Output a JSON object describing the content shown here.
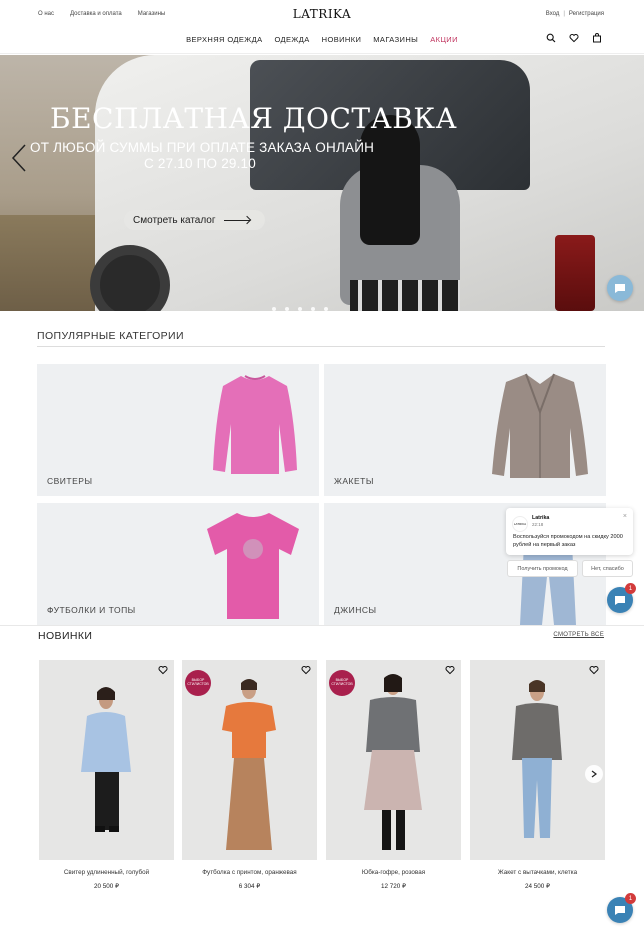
{
  "header": {
    "links": [
      "О нас",
      "Доставка и оплата",
      "Магазины"
    ],
    "logo": "LATRIKA",
    "login": "Вход",
    "separator": "|",
    "register": "Регистрация",
    "nav": [
      "ВЕРХНЯЯ ОДЕЖДА",
      "ОДЕЖДА",
      "НОВИНКИ",
      "МАГАЗИНЫ"
    ],
    "nav_promo": "АКЦИИ",
    "icons": [
      "search-icon",
      "heart-icon",
      "bag-icon"
    ]
  },
  "hero": {
    "title": "БЕСПЛАТНАЯ ДОСТАВКА",
    "subtitle_line1": "ОТ ЛЮБОЙ СУММЫ ПРИ ОПЛАТЕ ЗАКАЗА ОНЛАЙН",
    "subtitle_line2": "С 27.10 ПО 29.10",
    "button": "Смотреть каталог",
    "dots": 5
  },
  "categories": {
    "title": "ПОПУЛЯРНЫЕ КАТЕГОРИИ",
    "items": [
      "СВИТЕРЫ",
      "ЖАКЕТЫ",
      "ФУТБОЛКИ И ТОПЫ",
      "ДЖИНСЫ"
    ]
  },
  "novelties": {
    "title": "НОВИНКИ",
    "see_all": "СМОТРЕТЬ ВСЕ",
    "badge": "ВЫБОР СТИЛИСТОВ",
    "products": [
      {
        "name": "Свитер удлиненный, голубой",
        "price": "20 500 ₽"
      },
      {
        "name": "Футболка с принтом, оранжевая",
        "price": "6 304 ₽"
      },
      {
        "name": "Юбка-гофре, розовая",
        "price": "12 720 ₽"
      },
      {
        "name": "Жакет с вытачками, клетка",
        "price": "24 500 ₽"
      }
    ]
  },
  "chat": {
    "name": "Latrika",
    "time": "22:18",
    "avatar": "LATRIKA",
    "message": "Воспользуйся промокодом на скидку 2000 рублей на первый заказ",
    "btn_yes": "Получить промокод",
    "btn_no": "Нет, спасибо",
    "count": "1"
  },
  "colors": {
    "promo": "#c0335e",
    "badge": "#a9204d",
    "chat": "#3a82b5"
  }
}
